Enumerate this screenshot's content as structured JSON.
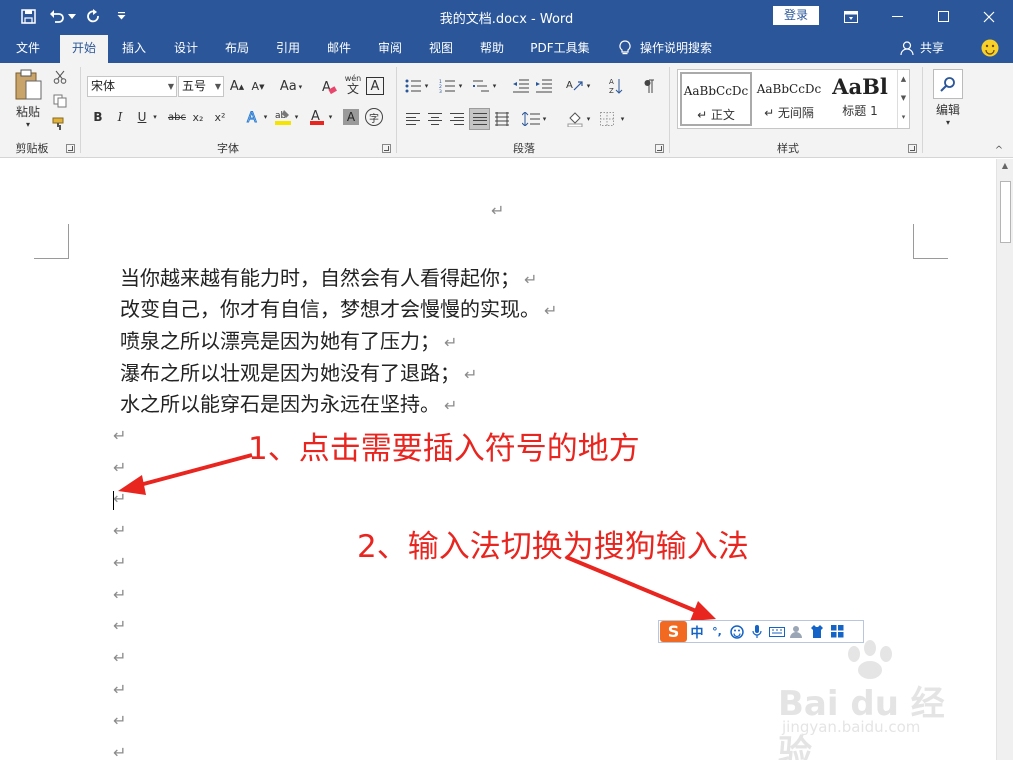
{
  "window": {
    "title": "我的文档.docx - Word",
    "login_label": "登录"
  },
  "tabs": [
    "文件",
    "开始",
    "插入",
    "设计",
    "布局",
    "引用",
    "邮件",
    "审阅",
    "视图",
    "帮助",
    "PDF工具集"
  ],
  "tell_me": "操作说明搜索",
  "share_label": "共享",
  "ribbon": {
    "clipboard": {
      "paste_label": "粘贴",
      "group_label": "剪贴板"
    },
    "font": {
      "font_name": "宋体",
      "font_size": "五号",
      "aa_label": "Aa",
      "wen_label": "wén",
      "bold": "B",
      "italic": "I",
      "underline": "U",
      "strike": "abc",
      "subscript": "x₂",
      "superscript": "x²",
      "group_label": "字体",
      "font_color": "#e8251f",
      "highlight_color": "#f5e400"
    },
    "paragraph": {
      "group_label": "段落"
    },
    "styles": {
      "group_label": "样式",
      "items": [
        {
          "sample": "AaBbCcDc",
          "name": "↵ 正文"
        },
        {
          "sample": "AaBbCcDc",
          "name": "↵ 无间隔"
        },
        {
          "sample": "AaBl",
          "name": "标题 1"
        }
      ]
    },
    "editing": {
      "label": "编辑"
    }
  },
  "document": {
    "paragraphs": [
      "当你越来越有能力时，自然会有人看得起你；",
      "改变自己，你才有自信，梦想才会慢慢的实现。",
      "喷泉之所以漂亮是因为她有了压力；",
      "瀑布之所以壮观是因为她没有了退路；",
      "水之所以能穿石是因为永远在坚持。"
    ],
    "paragraph_mark": "↵",
    "empty_paragraph_count": 11
  },
  "annotations": {
    "step1": "1、点击需要插入符号的地方",
    "step2": "2、输入法切换为搜狗输入法",
    "color": "#e8251f"
  },
  "ime": {
    "logo": "S",
    "mode": "中",
    "punct": "°,"
  },
  "watermark": {
    "brand": "Bai du 经验",
    "url": "jingyan.baidu.com"
  },
  "colors": {
    "title_bar": "#2b579a",
    "ribbon_bg": "#f3f3f3"
  }
}
